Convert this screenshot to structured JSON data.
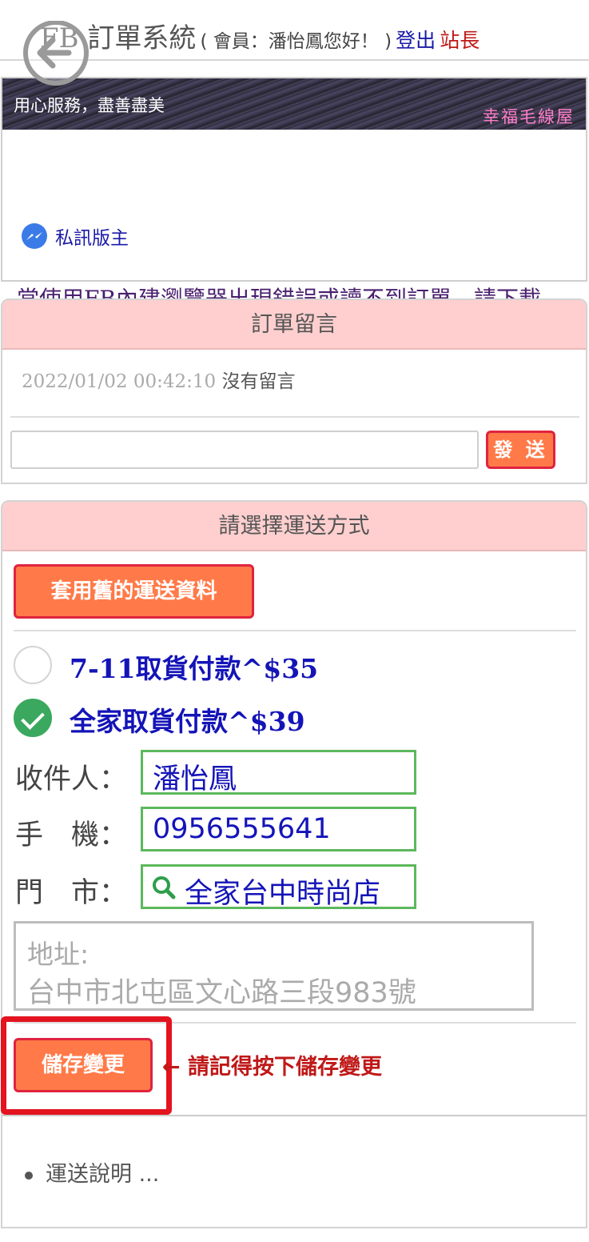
{
  "header": {
    "title": "FB 訂單系統",
    "member_text": "( 會員：潘怡鳳您好！ )",
    "logout": "登出",
    "admin": "站長"
  },
  "banner": {
    "slogan": "用心服務，盡善盡美",
    "brand": "幸福毛線屋",
    "pm_link": "私訊版主",
    "warning": "當使用FB內建瀏覽器出現錯誤或讀不到訂單，請下載 chrome 瀏覽器!"
  },
  "messages": {
    "header": "訂單留言",
    "timestamp": "2022/01/02 00:42:10",
    "text": "沒有留言",
    "input_value": "",
    "send_label": "發 送"
  },
  "shipping": {
    "header": "請選擇運送方式",
    "apply_old_label": "套用舊的運送資料",
    "options": [
      {
        "label": "7-11取貨付款^$35",
        "checked": false
      },
      {
        "label": "全家取貨付款^$39",
        "checked": true
      }
    ],
    "recipient_label": "收件人：",
    "recipient_value": "潘怡鳳",
    "phone_label": "手　機：",
    "phone_value": "0956555641",
    "store_label": "門　市：",
    "store_value": "全家台中時尚店",
    "address_label": "地址:",
    "address_value": "台中市北屯區文心路三段983號",
    "save_label": "儲存變更",
    "save_hint": "← 請記得按下儲存變更",
    "note": "運送說明 ..."
  },
  "colors": {
    "panel_header": "#ffcfcf",
    "button": "#ff7a48",
    "button_border": "#e0233f",
    "field_border": "#5cb85c",
    "link_blue": "#1a1aa8",
    "alert_red": "#c01818"
  }
}
